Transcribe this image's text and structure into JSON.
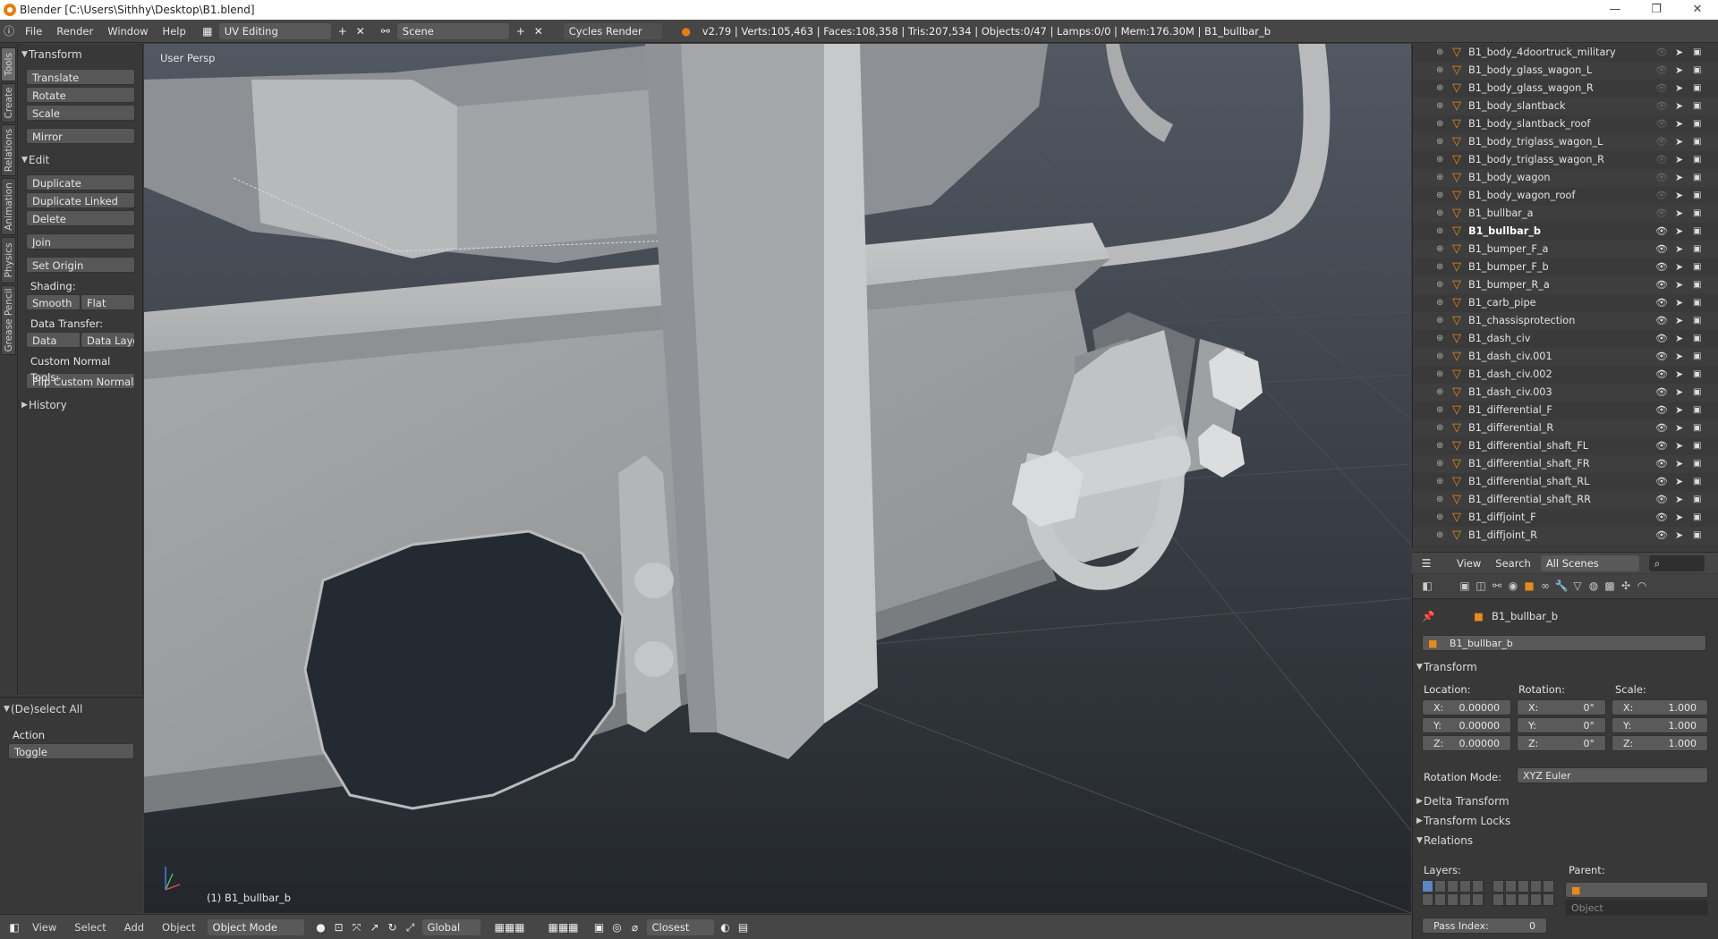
{
  "window": {
    "title": "Blender [C:\\Users\\Sithhy\\Desktop\\B1.blend]"
  },
  "topbar": {
    "menus": [
      "File",
      "Render",
      "Window",
      "Help"
    ],
    "screen_layout": "UV Editing",
    "scene": "Scene",
    "render_engine": "Cycles Render",
    "stats": "v2.79 | Verts:105,463 | Faces:108,358 | Tris:207,534 | Objects:0/47 | Lamps:0/0 | Mem:176.30M | B1_bullbar_b"
  },
  "vertical_tabs": [
    "Tools",
    "Create",
    "Relations",
    "Animation",
    "Physics",
    "Grease Pencil"
  ],
  "tools_panel": {
    "transform_header": "Transform",
    "translate": "Translate",
    "rotate": "Rotate",
    "scale": "Scale",
    "mirror": "Mirror",
    "edit_header": "Edit",
    "duplicate": "Duplicate",
    "duplicate_linked": "Duplicate Linked",
    "delete": "Delete",
    "join": "Join",
    "set_origin": "Set Origin",
    "shading_label": "Shading:",
    "smooth": "Smooth",
    "flat": "Flat",
    "data_transfer_label": "Data Transfer:",
    "data": "Data",
    "data_layout": "Data Layo",
    "custom_normal_label": "Custom Normal Tools:",
    "flip_normals": "Flip Custom Normals",
    "history_header": "History"
  },
  "operator_panel": {
    "header": "(De)select All",
    "action_label": "Action",
    "action_value": "Toggle"
  },
  "viewport": {
    "view_label": "User Persp",
    "object_label": "(1) B1_bullbar_b"
  },
  "bottombar": {
    "menus": [
      "View",
      "Select",
      "Add",
      "Object"
    ],
    "mode": "Object Mode",
    "orientation": "Global",
    "snap": "Closest"
  },
  "outliner": {
    "rows": [
      {
        "name": "B1_body_4doortruck_military",
        "visible": false
      },
      {
        "name": "B1_body_glass_wagon_L",
        "visible": false
      },
      {
        "name": "B1_body_glass_wagon_R",
        "visible": false
      },
      {
        "name": "B1_body_slantback",
        "visible": false
      },
      {
        "name": "B1_body_slantback_roof",
        "visible": false
      },
      {
        "name": "B1_body_triglass_wagon_L",
        "visible": false
      },
      {
        "name": "B1_body_triglass_wagon_R",
        "visible": false
      },
      {
        "name": "B1_body_wagon",
        "visible": false
      },
      {
        "name": "B1_body_wagon_roof",
        "visible": false
      },
      {
        "name": "B1_bullbar_a",
        "visible": false
      },
      {
        "name": "B1_bullbar_b",
        "visible": true,
        "active": true
      },
      {
        "name": "B1_bumper_F_a",
        "visible": true
      },
      {
        "name": "B1_bumper_F_b",
        "visible": true
      },
      {
        "name": "B1_bumper_R_a",
        "visible": true
      },
      {
        "name": "B1_carb_pipe",
        "visible": true
      },
      {
        "name": "B1_chassisprotection",
        "visible": true
      },
      {
        "name": "B1_dash_civ",
        "visible": true
      },
      {
        "name": "B1_dash_civ.001",
        "visible": true
      },
      {
        "name": "B1_dash_civ.002",
        "visible": true
      },
      {
        "name": "B1_dash_civ.003",
        "visible": true
      },
      {
        "name": "B1_differential_F",
        "visible": true
      },
      {
        "name": "B1_differential_R",
        "visible": true
      },
      {
        "name": "B1_differential_shaft_FL",
        "visible": true
      },
      {
        "name": "B1_differential_shaft_FR",
        "visible": true
      },
      {
        "name": "B1_differential_shaft_RL",
        "visible": true
      },
      {
        "name": "B1_differential_shaft_RR",
        "visible": true
      },
      {
        "name": "B1_diffjoint_F",
        "visible": true
      },
      {
        "name": "B1_diffjoint_R",
        "visible": true
      }
    ],
    "header": {
      "view": "View",
      "search": "Search",
      "filter": "All Scenes"
    }
  },
  "properties": {
    "context_object": "B1_bullbar_b",
    "object_name": "B1_bullbar_b",
    "transform_header": "Transform",
    "location_label": "Location:",
    "rotation_label": "Rotation:",
    "scale_label": "Scale:",
    "loc_x": "0.00000",
    "loc_y": "0.00000",
    "loc_z": "0.00000",
    "rot_x": "0°",
    "rot_y": "0°",
    "rot_z": "0°",
    "scale_x": "1.000",
    "scale_y": "1.000",
    "scale_z": "1.000",
    "axis_x": "X:",
    "axis_y": "Y:",
    "axis_z": "Z:",
    "rotation_mode_label": "Rotation Mode:",
    "rotation_mode": "XYZ Euler",
    "delta_transform": "Delta Transform",
    "transform_locks": "Transform Locks",
    "relations_header": "Relations",
    "layers_label": "Layers:",
    "parent_label": "Parent:",
    "parent_type": "Object",
    "pass_index_label": "Pass Index:",
    "pass_index": "0"
  }
}
